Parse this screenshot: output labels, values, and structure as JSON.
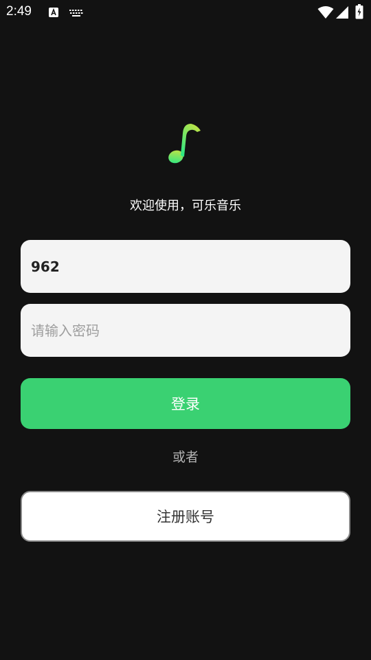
{
  "status_bar": {
    "time": "2:49",
    "icons": [
      "accessibility-a-icon",
      "keyboard-icon",
      "wifi-icon",
      "cell-signal-icon",
      "battery-charging-icon"
    ]
  },
  "app": {
    "logo_icon": "music-note-icon",
    "welcome_text": "欢迎使用，可乐音乐"
  },
  "form": {
    "username_value": "962",
    "username_placeholder": "",
    "password_value": "",
    "password_placeholder": "请输入密码",
    "login_label": "登录",
    "or_label": "或者",
    "register_label": "注册账号"
  },
  "colors": {
    "background": "#121212",
    "accent": "#3ad172",
    "field_bg": "#f4f4f4"
  }
}
